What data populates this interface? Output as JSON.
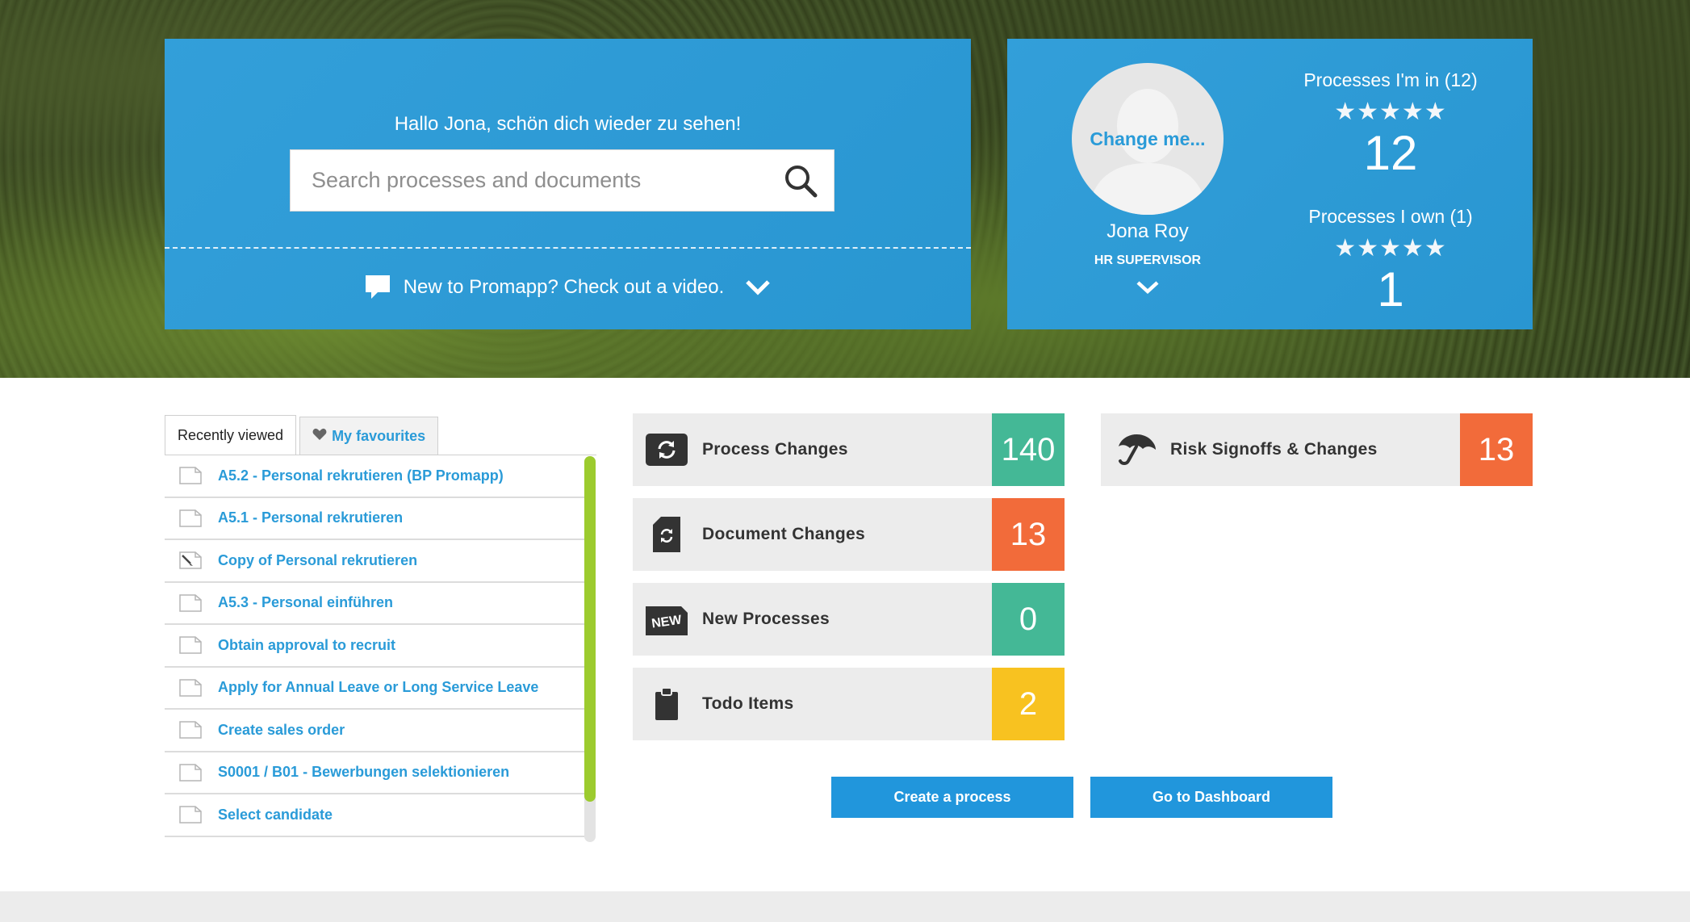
{
  "welcome": {
    "greeting": "Hallo Jona, schön dich wieder zu sehen!",
    "search_placeholder": "Search processes and documents",
    "video_prompt": "New to Promapp? Check out a video."
  },
  "profile": {
    "avatar_link": "Change me...",
    "name": "Jona Roy",
    "role": "HR SUPERVISOR",
    "stats": [
      {
        "title": "Processes I'm in (12)",
        "stars": "★★★★★",
        "value": "12"
      },
      {
        "title": "Processes I own (1)",
        "stars": "★★★★★",
        "value": "1"
      }
    ]
  },
  "tabs": {
    "recent": "Recently viewed",
    "favourites": "My favourites"
  },
  "recent_items": [
    {
      "label": "A5.2 - Personal rekrutieren (BP Promapp)",
      "icon": "document-icon"
    },
    {
      "label": "A5.1 - Personal rekrutieren",
      "icon": "document-icon"
    },
    {
      "label": "Copy of Personal rekrutieren",
      "icon": "document-edit-icon"
    },
    {
      "label": "A5.3 - Personal einführen",
      "icon": "document-icon"
    },
    {
      "label": "Obtain approval to recruit",
      "icon": "document-icon"
    },
    {
      "label": "Apply for Annual Leave or Long Service Leave",
      "icon": "document-icon"
    },
    {
      "label": "Create sales order",
      "icon": "document-icon"
    },
    {
      "label": "S0001 / B01 - Bewerbungen selektionieren",
      "icon": "document-icon"
    },
    {
      "label": "Select candidate",
      "icon": "document-icon"
    }
  ],
  "tiles": {
    "process_changes": {
      "label": "Process Changes",
      "count": "140",
      "color": "#44b896",
      "icon": "refresh-icon"
    },
    "document_changes": {
      "label": "Document Changes",
      "count": "13",
      "color": "#f26b3a",
      "icon": "document-refresh-icon"
    },
    "new_processes": {
      "label": "New Processes",
      "count": "0",
      "color": "#44b896",
      "icon": "new-badge-icon"
    },
    "todo_items": {
      "label": "Todo Items",
      "count": "2",
      "color": "#f8c220",
      "icon": "clipboard-icon"
    },
    "risk": {
      "label": "Risk Signoffs & Changes",
      "count": "13",
      "color": "#f26b3a",
      "icon": "umbrella-icon"
    }
  },
  "buttons": {
    "create_process": "Create a process",
    "dashboard": "Go to Dashboard"
  }
}
